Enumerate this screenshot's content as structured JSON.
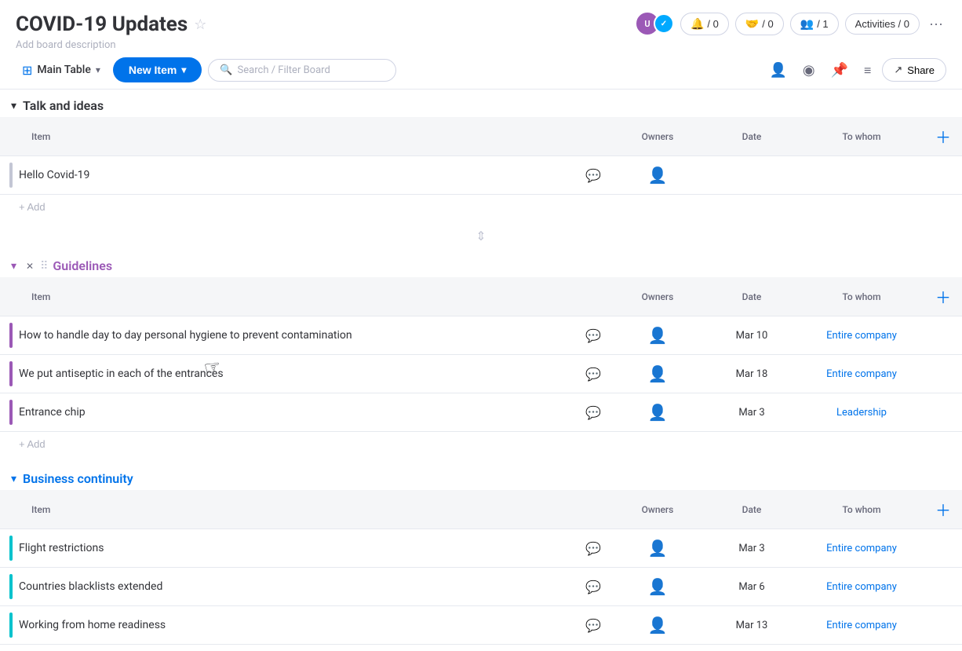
{
  "board": {
    "title": "COVID-19 Updates",
    "description": "Add board description"
  },
  "header_actions": {
    "reactions_count": "/ 0",
    "share_count": "/ 0",
    "members_count": "/ 1",
    "activities": "Activities / 0",
    "share_label": "Share"
  },
  "toolbar": {
    "main_table_label": "Main Table",
    "new_item_label": "New Item",
    "search_placeholder": "Search / Filter Board"
  },
  "groups": [
    {
      "id": "talk-and-ideas",
      "title": "Talk and ideas",
      "color": "gray",
      "columns": [
        "Owners",
        "Date",
        "To whom"
      ],
      "rows": [
        {
          "id": 1,
          "name": "Hello Covid-19",
          "owners": "",
          "date": "",
          "to_whom": ""
        }
      ],
      "add_label": "+ Add"
    },
    {
      "id": "guidelines",
      "title": "Guidelines",
      "color": "purple",
      "columns": [
        "Owners",
        "Date",
        "To whom"
      ],
      "rows": [
        {
          "id": 2,
          "name": "How to handle day to day personal hygiene to prevent contamination",
          "owners": "",
          "date": "Mar 10",
          "to_whom": "Entire company"
        },
        {
          "id": 3,
          "name": "We put antiseptic in each of the entrances",
          "owners": "",
          "date": "Mar 18",
          "to_whom": "Entire company"
        },
        {
          "id": 4,
          "name": "Entrance chip",
          "owners": "",
          "date": "Mar 3",
          "to_whom": "Leadership"
        }
      ],
      "add_label": "+ Add"
    },
    {
      "id": "business-continuity",
      "title": "Business continuity",
      "color": "blue",
      "columns": [
        "Owners",
        "Date",
        "To whom"
      ],
      "rows": [
        {
          "id": 5,
          "name": "Flight restrictions",
          "owners": "",
          "date": "Mar 3",
          "to_whom": "Entire company"
        },
        {
          "id": 6,
          "name": "Countries blacklists extended",
          "owners": "",
          "date": "Mar 6",
          "to_whom": "Entire company"
        },
        {
          "id": 7,
          "name": "Working from home readiness",
          "owners": "",
          "date": "Mar 13",
          "to_whom": "Entire company"
        }
      ],
      "add_label": "+ Add"
    }
  ],
  "icons": {
    "star": "☆",
    "grid": "⊞",
    "chevron_down": "▾",
    "search": "🔍",
    "person": "👤",
    "eye": "◉",
    "pin": "📌",
    "filter": "≡",
    "share_arrow": "↗",
    "more": "···",
    "chat": "💬",
    "owner": "👤",
    "add": "＋",
    "collapse": "▾",
    "drag": "⠿",
    "close": "✕"
  }
}
